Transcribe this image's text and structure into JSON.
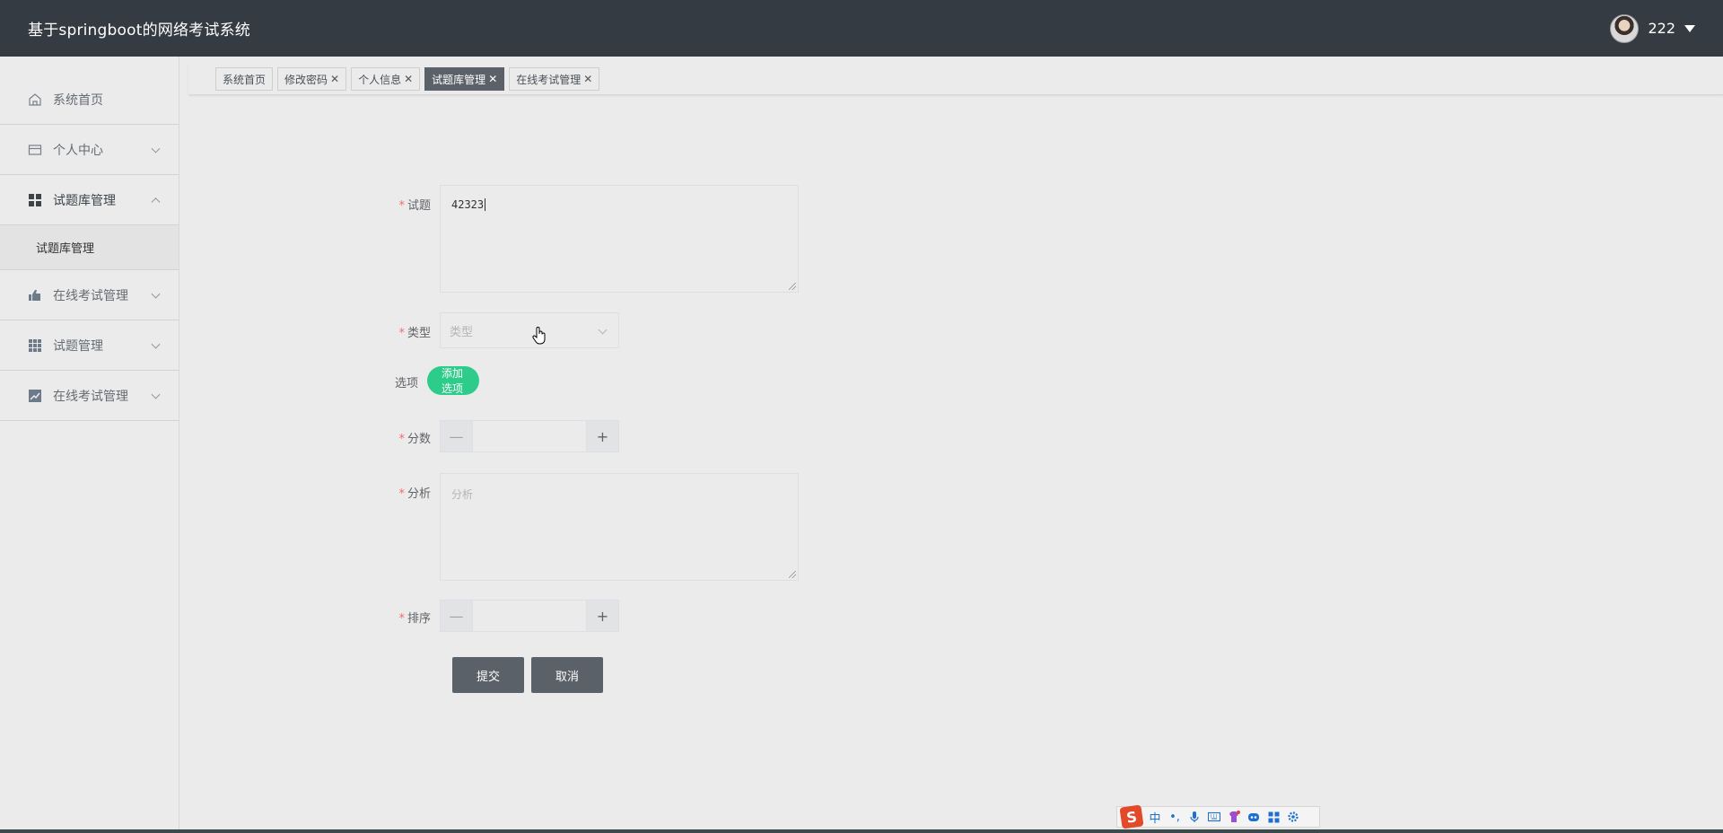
{
  "header": {
    "title": "基于springboot的网络考试系统",
    "username": "222",
    "avatar_icon": "user-avatar",
    "caret_icon": "caret-down-icon"
  },
  "sidebar": {
    "items": [
      {
        "label": "系统首页",
        "icon": "home-icon"
      },
      {
        "label": "个人中心",
        "icon": "credit-card-icon"
      },
      {
        "label": "试题库管理",
        "icon": "grid-icon",
        "expanded": true
      },
      {
        "label": "在线考试管理",
        "icon": "thumb-icon"
      },
      {
        "label": "试题管理",
        "icon": "apps-icon"
      },
      {
        "label": "在线考试管理",
        "icon": "chart-icon"
      }
    ],
    "submenu": [
      {
        "label": "试题库管理"
      }
    ]
  },
  "tabs": [
    {
      "label": "系统首页",
      "closable": false,
      "active": false
    },
    {
      "label": "修改密码",
      "closable": true,
      "active": false
    },
    {
      "label": "个人信息",
      "closable": true,
      "active": false
    },
    {
      "label": "试题库管理",
      "closable": true,
      "active": true
    },
    {
      "label": "在线考试管理",
      "closable": true,
      "active": false
    }
  ],
  "tab_close": "✕",
  "form": {
    "required_mark": "*",
    "question": {
      "label": "试题",
      "value": "42323"
    },
    "type": {
      "label": "类型",
      "placeholder": "类型"
    },
    "options": {
      "label": "选项",
      "add_button": "添加选项"
    },
    "score": {
      "label": "分数",
      "minus": "—",
      "plus": "+"
    },
    "analysis": {
      "label": "分析",
      "placeholder": "分析"
    },
    "order": {
      "label": "排序",
      "minus": "—",
      "plus": "+"
    },
    "submit_button": "提交",
    "cancel_button": "取消"
  },
  "ime": {
    "logo": "S",
    "mode": "中",
    "punct": "•,"
  },
  "colors": {
    "header_bg": "#343b43",
    "accent_green": "#2ecc8a",
    "active_tab": "#5b6168",
    "required": "#f56c6c"
  }
}
